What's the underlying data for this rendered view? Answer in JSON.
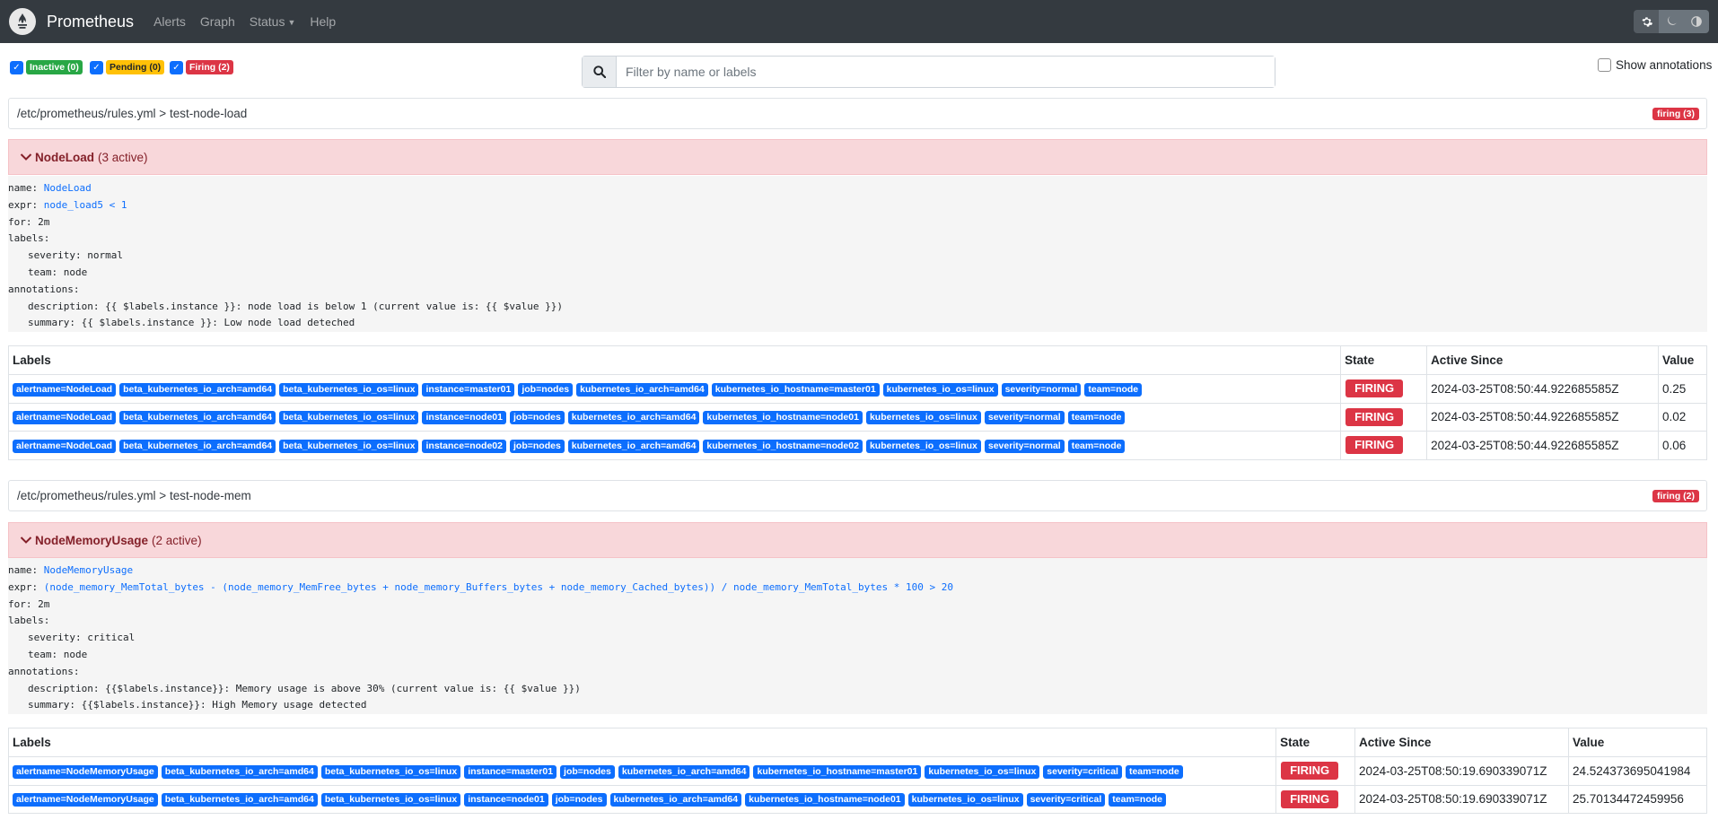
{
  "navbar": {
    "brand": "Prometheus",
    "links": [
      {
        "label": "Alerts"
      },
      {
        "label": "Graph"
      },
      {
        "label": "Status",
        "dropdown": true
      },
      {
        "label": "Help"
      }
    ],
    "theme_buttons": [
      "gear-icon",
      "moon-icon",
      "contrast-icon"
    ],
    "colors": {
      "navbar_bg": "#343a40"
    }
  },
  "filters": {
    "inactive": "Inactive (0)",
    "pending": "Pending (0)",
    "firing": "Firing (2)",
    "search_placeholder": "Filter by name or labels",
    "show_annotations": "Show annotations",
    "colors": {
      "inactive": "#28a745",
      "pending": "#ffc107",
      "firing": "#dc3545"
    }
  },
  "groups": [
    {
      "path": "/etc/prometheus/rules.yml > test-node-load",
      "badge": "firing (3)",
      "rule": {
        "name": "NodeLoad",
        "active": "(3 active)",
        "def": {
          "name_key": "name:",
          "name_val": "NodeLoad",
          "expr_key": "expr:",
          "expr_val": "node_load5 < 1",
          "for": "for: 2m",
          "labels": "labels:",
          "label_lines": [
            "severity: normal",
            "team: node"
          ],
          "annotations": "annotations:",
          "annotation_lines": [
            "description: {{ $labels.instance }}: node load is below 1 (current value is: {{ $value }})",
            "summary: {{ $labels.instance }}: Low node load deteched"
          ]
        }
      },
      "table": {
        "headers": [
          "Labels",
          "State",
          "Active Since",
          "Value"
        ],
        "rows": [
          {
            "labels": [
              "alertname=NodeLoad",
              "beta_kubernetes_io_arch=amd64",
              "beta_kubernetes_io_os=linux",
              "instance=master01",
              "job=nodes",
              "kubernetes_io_arch=amd64",
              "kubernetes_io_hostname=master01",
              "kubernetes_io_os=linux",
              "severity=normal",
              "team=node"
            ],
            "state": "FIRING",
            "active_since": "2024-03-25T08:50:44.922685585Z",
            "value": "0.25"
          },
          {
            "labels": [
              "alertname=NodeLoad",
              "beta_kubernetes_io_arch=amd64",
              "beta_kubernetes_io_os=linux",
              "instance=node01",
              "job=nodes",
              "kubernetes_io_arch=amd64",
              "kubernetes_io_hostname=node01",
              "kubernetes_io_os=linux",
              "severity=normal",
              "team=node"
            ],
            "state": "FIRING",
            "active_since": "2024-03-25T08:50:44.922685585Z",
            "value": "0.02"
          },
          {
            "labels": [
              "alertname=NodeLoad",
              "beta_kubernetes_io_arch=amd64",
              "beta_kubernetes_io_os=linux",
              "instance=node02",
              "job=nodes",
              "kubernetes_io_arch=amd64",
              "kubernetes_io_hostname=node02",
              "kubernetes_io_os=linux",
              "severity=normal",
              "team=node"
            ],
            "state": "FIRING",
            "active_since": "2024-03-25T08:50:44.922685585Z",
            "value": "0.06"
          }
        ]
      }
    },
    {
      "path": "/etc/prometheus/rules.yml > test-node-mem",
      "badge": "firing (2)",
      "rule": {
        "name": "NodeMemoryUsage",
        "active": "(2 active)",
        "def": {
          "name_key": "name:",
          "name_val": "NodeMemoryUsage",
          "expr_key": "expr:",
          "expr_val": "(node_memory_MemTotal_bytes - (node_memory_MemFree_bytes + node_memory_Buffers_bytes + node_memory_Cached_bytes)) / node_memory_MemTotal_bytes * 100 > 20",
          "for": "for: 2m",
          "labels": "labels:",
          "label_lines": [
            "severity: critical",
            "team: node"
          ],
          "annotations": "annotations:",
          "annotation_lines": [
            "description: {{$labels.instance}}: Memory usage is above 30% (current value is: {{ $value }})",
            "summary: {{$labels.instance}}: High Memory usage detected"
          ]
        }
      },
      "table": {
        "headers": [
          "Labels",
          "State",
          "Active Since",
          "Value"
        ],
        "rows": [
          {
            "labels": [
              "alertname=NodeMemoryUsage",
              "beta_kubernetes_io_arch=amd64",
              "beta_kubernetes_io_os=linux",
              "instance=master01",
              "job=nodes",
              "kubernetes_io_arch=amd64",
              "kubernetes_io_hostname=master01",
              "kubernetes_io_os=linux",
              "severity=critical",
              "team=node"
            ],
            "state": "FIRING",
            "active_since": "2024-03-25T08:50:19.690339071Z",
            "value": "24.524373695041984"
          },
          {
            "labels": [
              "alertname=NodeMemoryUsage",
              "beta_kubernetes_io_arch=amd64",
              "beta_kubernetes_io_os=linux",
              "instance=node01",
              "job=nodes",
              "kubernetes_io_arch=amd64",
              "kubernetes_io_hostname=node01",
              "kubernetes_io_os=linux",
              "severity=critical",
              "team=node"
            ],
            "state": "FIRING",
            "active_since": "2024-03-25T08:50:19.690339071Z",
            "value": "25.70134472459956"
          }
        ]
      }
    }
  ]
}
